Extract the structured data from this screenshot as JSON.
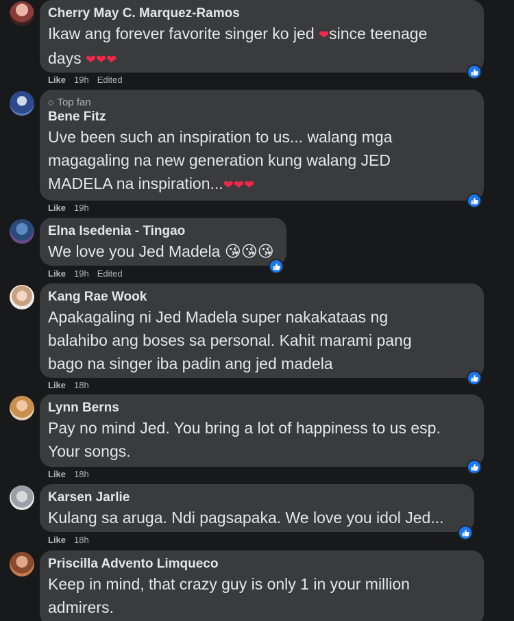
{
  "ui": {
    "like_label": "Like",
    "top_fan_label": "Top fan"
  },
  "comments": [
    {
      "name": "Cherry May C. Marquez-Ramos",
      "lines": [
        "Ikaw ang forever favorite singer ko jed ❤since teenage",
        "days ❤❤❤"
      ],
      "time": "19h",
      "edited": "Edited"
    },
    {
      "name": "Bene Fitz",
      "top_fan": true,
      "lines": [
        "Uve been such an inspiration to us... walang mga",
        "magagaling na new generation kung walang JED",
        "MADELA na inspiration...❤❤❤"
      ],
      "time": "19h",
      "edited": ""
    },
    {
      "name": "Elna Isedenia - Tingao",
      "lines": [
        "We love you Jed Madela 😘😘😘"
      ],
      "time": "19h",
      "edited": "Edited"
    },
    {
      "name": "Kang Rae Wook",
      "lines": [
        "Apakagaling ni Jed Madela super nakakataas ng",
        "balahibo ang boses sa personal. Kahit marami pang",
        "bago na singer iba padin ang jed madela"
      ],
      "time": "18h",
      "edited": ""
    },
    {
      "name": "Lynn Berns",
      "lines": [
        "Pay no mind Jed. You bring a lot of happiness to us esp.",
        "Your songs."
      ],
      "time": "18h",
      "edited": ""
    },
    {
      "name": "Karsen Jarlie",
      "lines": [
        "Kulang sa aruga. Ndi pagsapaka. We love you idol Jed..."
      ],
      "time": "18h",
      "edited": ""
    },
    {
      "name": "Priscilla Advento Limqueco",
      "lines": [
        "Keep in mind, that crazy guy is only 1 in your million",
        "admirers."
      ],
      "time": "",
      "edited": ""
    }
  ]
}
